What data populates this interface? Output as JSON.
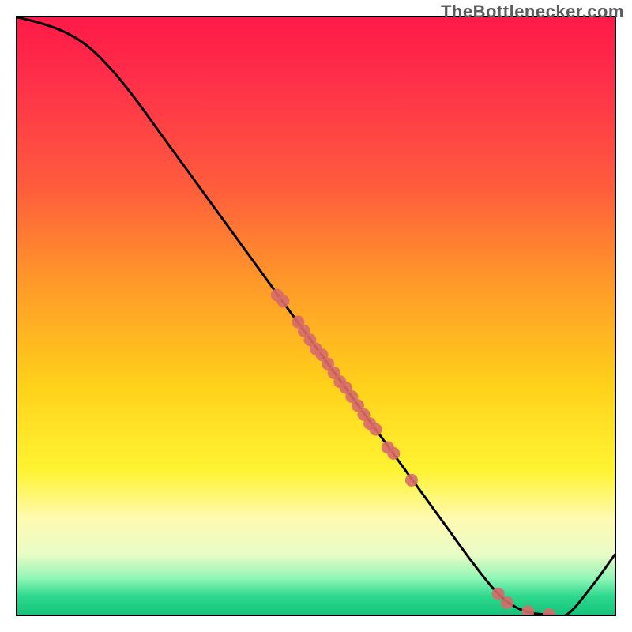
{
  "watermark_text": "TheBottlenecker.com",
  "chart_data": {
    "type": "line",
    "title": "",
    "xlabel": "",
    "ylabel": "",
    "xlim": [
      0,
      100
    ],
    "ylim": [
      0,
      100
    ],
    "gradient_stops": [
      {
        "pct": 0,
        "color": "#ff1a47"
      },
      {
        "pct": 10,
        "color": "#ff2e4a"
      },
      {
        "pct": 28,
        "color": "#ff5b3d"
      },
      {
        "pct": 45,
        "color": "#ff9b28"
      },
      {
        "pct": 62,
        "color": "#ffd21a"
      },
      {
        "pct": 76,
        "color": "#fff433"
      },
      {
        "pct": 84,
        "color": "#fffab2"
      },
      {
        "pct": 90,
        "color": "#e9fcc7"
      },
      {
        "pct": 94,
        "color": "#8ef5b5"
      },
      {
        "pct": 97,
        "color": "#2bd88c"
      },
      {
        "pct": 100,
        "color": "#18c27b"
      }
    ],
    "series": [
      {
        "name": "bottleneck-curve",
        "stroke": "#000000",
        "stroke_width": 2,
        "x": [
          0,
          4,
          8,
          12,
          16,
          20,
          24,
          28,
          32,
          36,
          40,
          44,
          48,
          52,
          56,
          60,
          64,
          68,
          72,
          76,
          80,
          83,
          86,
          89,
          92,
          96,
          100
        ],
        "y": [
          100,
          99,
          97.5,
          95,
          91,
          86,
          80.5,
          75,
          69.5,
          64,
          58.5,
          53,
          47.5,
          42,
          36.5,
          31,
          25.5,
          20,
          14.5,
          9,
          4,
          1.5,
          0.3,
          0,
          0,
          4.5,
          10
        ]
      }
    ],
    "scatter": {
      "name": "data-points",
      "color": "#d86a6a",
      "opacity": 0.9,
      "radius": 8,
      "points": [
        {
          "x": 43.5,
          "y": 53.5
        },
        {
          "x": 44.5,
          "y": 52.5
        },
        {
          "x": 47.0,
          "y": 49.0
        },
        {
          "x": 48.0,
          "y": 47.5
        },
        {
          "x": 49.0,
          "y": 46.0
        },
        {
          "x": 50.0,
          "y": 44.5
        },
        {
          "x": 51.0,
          "y": 43.5
        },
        {
          "x": 52.0,
          "y": 42.0
        },
        {
          "x": 53.0,
          "y": 40.5
        },
        {
          "x": 54.0,
          "y": 39.0
        },
        {
          "x": 55.0,
          "y": 38.0
        },
        {
          "x": 56.0,
          "y": 36.5
        },
        {
          "x": 57.0,
          "y": 35.0
        },
        {
          "x": 58.0,
          "y": 33.5
        },
        {
          "x": 59.0,
          "y": 32.0
        },
        {
          "x": 60.0,
          "y": 31.0
        },
        {
          "x": 62.0,
          "y": 28.0
        },
        {
          "x": 63.0,
          "y": 27.0
        },
        {
          "x": 66.0,
          "y": 22.5
        },
        {
          "x": 80.5,
          "y": 3.5
        },
        {
          "x": 82.0,
          "y": 2.0
        },
        {
          "x": 85.5,
          "y": 0.5
        },
        {
          "x": 89.0,
          "y": 0.0
        }
      ]
    }
  }
}
